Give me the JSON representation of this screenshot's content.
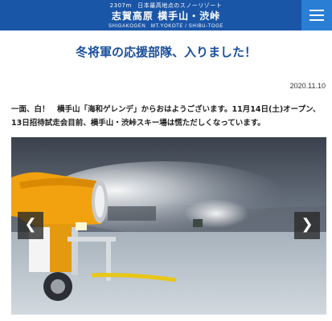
{
  "header": {
    "tagline": "2307m　日本最高地点のスノーリゾート",
    "title_jp": "志賀高原 横手山・渋峠",
    "title_en": "SHIGAKOGEN　MT.YOKOTE / SHIBU-TOGE",
    "menu_icon": "hamburger-icon",
    "colors": {
      "header_bg": "#1a56a8",
      "menu_bg": "#2a7fd4"
    }
  },
  "article": {
    "headline": "冬将軍の応援部隊、入りました！",
    "date": "2020.11.10",
    "body": "一面、白！　横手山「海和ゲレンデ」からおはようございます。11月14日(土)オープン、13日招待試走会目前、横手山・渋峠スキー場は慌ただしくなっています。"
  },
  "carousel": {
    "prev_label": "❮",
    "next_label": "❯",
    "image_subject": "snow-gun"
  }
}
